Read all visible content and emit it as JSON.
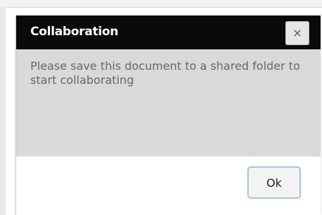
{
  "dialog": {
    "title": "Collaboration",
    "close_icon": "close-icon",
    "close_glyph": "×",
    "message": "Please save this document to a shared folder to start collaborating",
    "ok_label": "Ok"
  },
  "colors": {
    "titlebar": "#0a0a0a",
    "body": "#d9d9d9",
    "message_text": "#666666",
    "ok_border": "#a9c2dc"
  }
}
